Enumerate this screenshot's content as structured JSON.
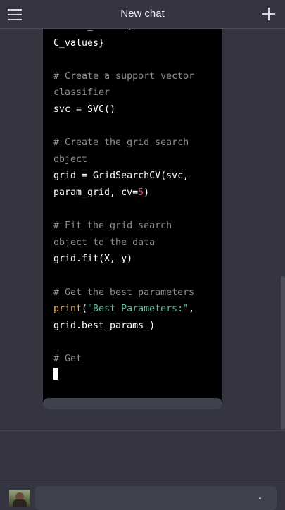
{
  "header": {
    "title": "New chat",
    "menu_icon": "hamburger-menu-icon",
    "new_chat_icon": "plus-icon"
  },
  "code": {
    "lines": [
      [
        {
          "t": "kernel_values, ",
          "c": ""
        },
        {
          "t": "'C'",
          "c": "str"
        },
        {
          "t": ":",
          "c": ""
        }
      ],
      [
        {
          "t": "C_values}",
          "c": ""
        }
      ],
      [],
      [
        {
          "t": "# Create a support vector",
          "c": "cm"
        }
      ],
      [
        {
          "t": "classifier",
          "c": "cm"
        }
      ],
      [
        {
          "t": "svc = SVC()",
          "c": ""
        }
      ],
      [],
      [
        {
          "t": "# Create the grid search",
          "c": "cm"
        }
      ],
      [
        {
          "t": "object",
          "c": "cm"
        }
      ],
      [
        {
          "t": "grid = GridSearchCV(svc,",
          "c": ""
        }
      ],
      [
        {
          "t": "param_grid, cv=",
          "c": ""
        },
        {
          "t": "5",
          "c": "num"
        },
        {
          "t": ")",
          "c": ""
        }
      ],
      [],
      [
        {
          "t": "# Fit the grid search",
          "c": "cm"
        }
      ],
      [
        {
          "t": "object to the data",
          "c": "cm"
        }
      ],
      [
        {
          "t": "grid.fit(X, y)",
          "c": ""
        }
      ],
      [],
      [
        {
          "t": "# Get the best parameters",
          "c": "cm"
        }
      ],
      [
        {
          "t": "print",
          "c": "kw"
        },
        {
          "t": "(",
          "c": ""
        },
        {
          "t": "\"Best Parameters:\"",
          "c": "str"
        },
        {
          "t": ",",
          "c": ""
        }
      ],
      [
        {
          "t": "grid.best_params_)",
          "c": ""
        }
      ],
      [],
      [
        {
          "t": "# Get",
          "c": "cm"
        }
      ],
      [
        {
          "t": "",
          "c": "cursor"
        }
      ]
    ]
  },
  "colors": {
    "background": "#343541",
    "code_background": "#000000",
    "comment": "#8e8e98",
    "string": "#57c19a",
    "number": "#e0446a",
    "keyword": "#e9b45d"
  },
  "composer": {
    "avatar": "user-avatar",
    "input_value": ""
  }
}
